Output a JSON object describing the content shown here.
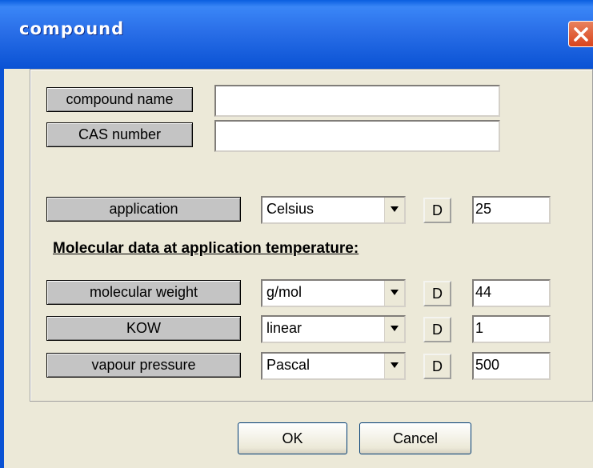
{
  "window": {
    "title": "compound"
  },
  "fields": {
    "compound_name": {
      "label": "compound name",
      "value": ""
    },
    "cas_number": {
      "label": "CAS number",
      "value": ""
    }
  },
  "application": {
    "label": "application",
    "unit": "Celsius",
    "default_btn": "D",
    "value": "25"
  },
  "section_title": "Molecular data at application temperature:",
  "rows": [
    {
      "label": "molecular weight",
      "unit": "g/mol",
      "default_btn": "D",
      "value": "44"
    },
    {
      "label": "KOW",
      "unit": "linear",
      "default_btn": "D",
      "value": "1"
    },
    {
      "label": "vapour pressure",
      "unit": "Pascal",
      "default_btn": "D",
      "value": "500"
    }
  ],
  "buttons": {
    "ok": "OK",
    "cancel": "Cancel"
  }
}
